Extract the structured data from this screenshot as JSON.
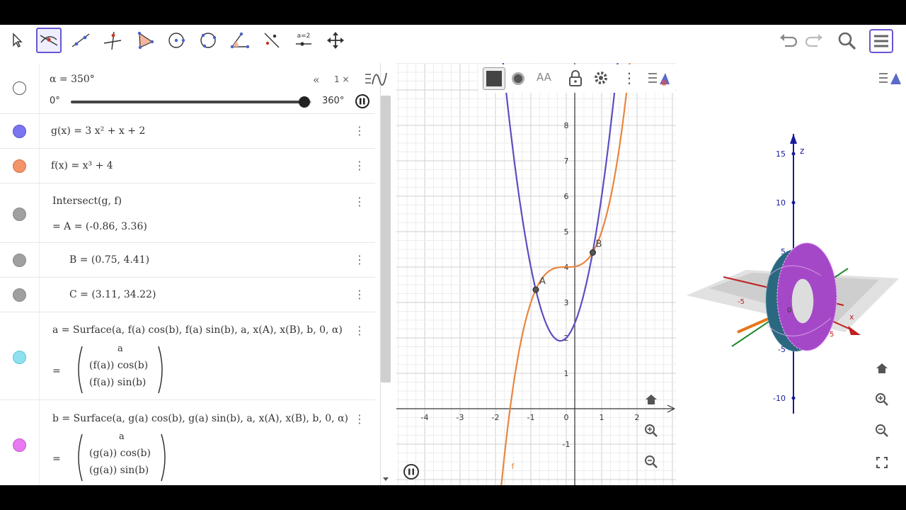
{
  "colors": {
    "accent": "#6557d2",
    "marble_blue": "#7b76f0",
    "marble_orange": "#f39469",
    "marble_gray": "#a0a0a0",
    "marble_cyan": "#8fe1f0",
    "marble_pink": "#e77af0",
    "curve_g": "#5b4ec0",
    "curve_f": "#e88640"
  },
  "toolbar": {
    "tools": [
      "move-tool",
      "intersect-tool",
      "line-tool",
      "perpendicular-tool",
      "polygon-tool",
      "circle-tool",
      "circle-three-points-tool",
      "angle-tool",
      "reflect-tool",
      "slider-tool",
      "move-view-tool"
    ],
    "slider_tool_label": "a=2"
  },
  "algebra": {
    "slider": {
      "label": "α = 350°",
      "min": "0°",
      "max": "360°",
      "speed": "1 ×",
      "value_fraction": 0.972
    },
    "g_def": "g(x)  =  3 x² + x + 2",
    "f_def": "f(x)  =  x³ + 4",
    "intersect_cmd": "Intersect(g, f)",
    "point_a": "=  A = (-0.86, 3.36)",
    "point_b": "B = (0.75, 4.41)",
    "point_c": "C = (3.11, 34.22)",
    "surf_a_def": "a  =  Surface(a, f(a)  cos(b), f(a)  sin(b), a, x(A), x(B), b, 0, α)",
    "surf_a_r1": "a",
    "surf_a_r2": "(f(a))  cos(b)",
    "surf_a_r3": "(f(a))  sin(b)",
    "surf_b_def": "b  =  Surface(a, g(a)  cos(b), g(a)  sin(b), a, x(A), x(B), b, 0, α)",
    "surf_b_r1": "a",
    "surf_b_r2": "(g(a))  cos(b)",
    "surf_b_r3": "(g(a))  sin(b)",
    "equals": "="
  },
  "graphics2d": {
    "x_ticks": [
      "-4",
      "-3",
      "-2",
      "-1",
      "0",
      "1",
      "2"
    ],
    "y_ticks": [
      "8",
      "7",
      "6",
      "5",
      "4",
      "3",
      "2",
      "1",
      "-1"
    ],
    "label_a": "A",
    "label_b": "B",
    "label_f": "f",
    "style_bar_text": "AA"
  },
  "graphics3d": {
    "z_label": "z",
    "z_ticks": [
      "15",
      "10",
      "5",
      "-5",
      "-10"
    ],
    "plane_ticks": [
      "-5",
      "0",
      "5"
    ],
    "x_label": "x"
  }
}
